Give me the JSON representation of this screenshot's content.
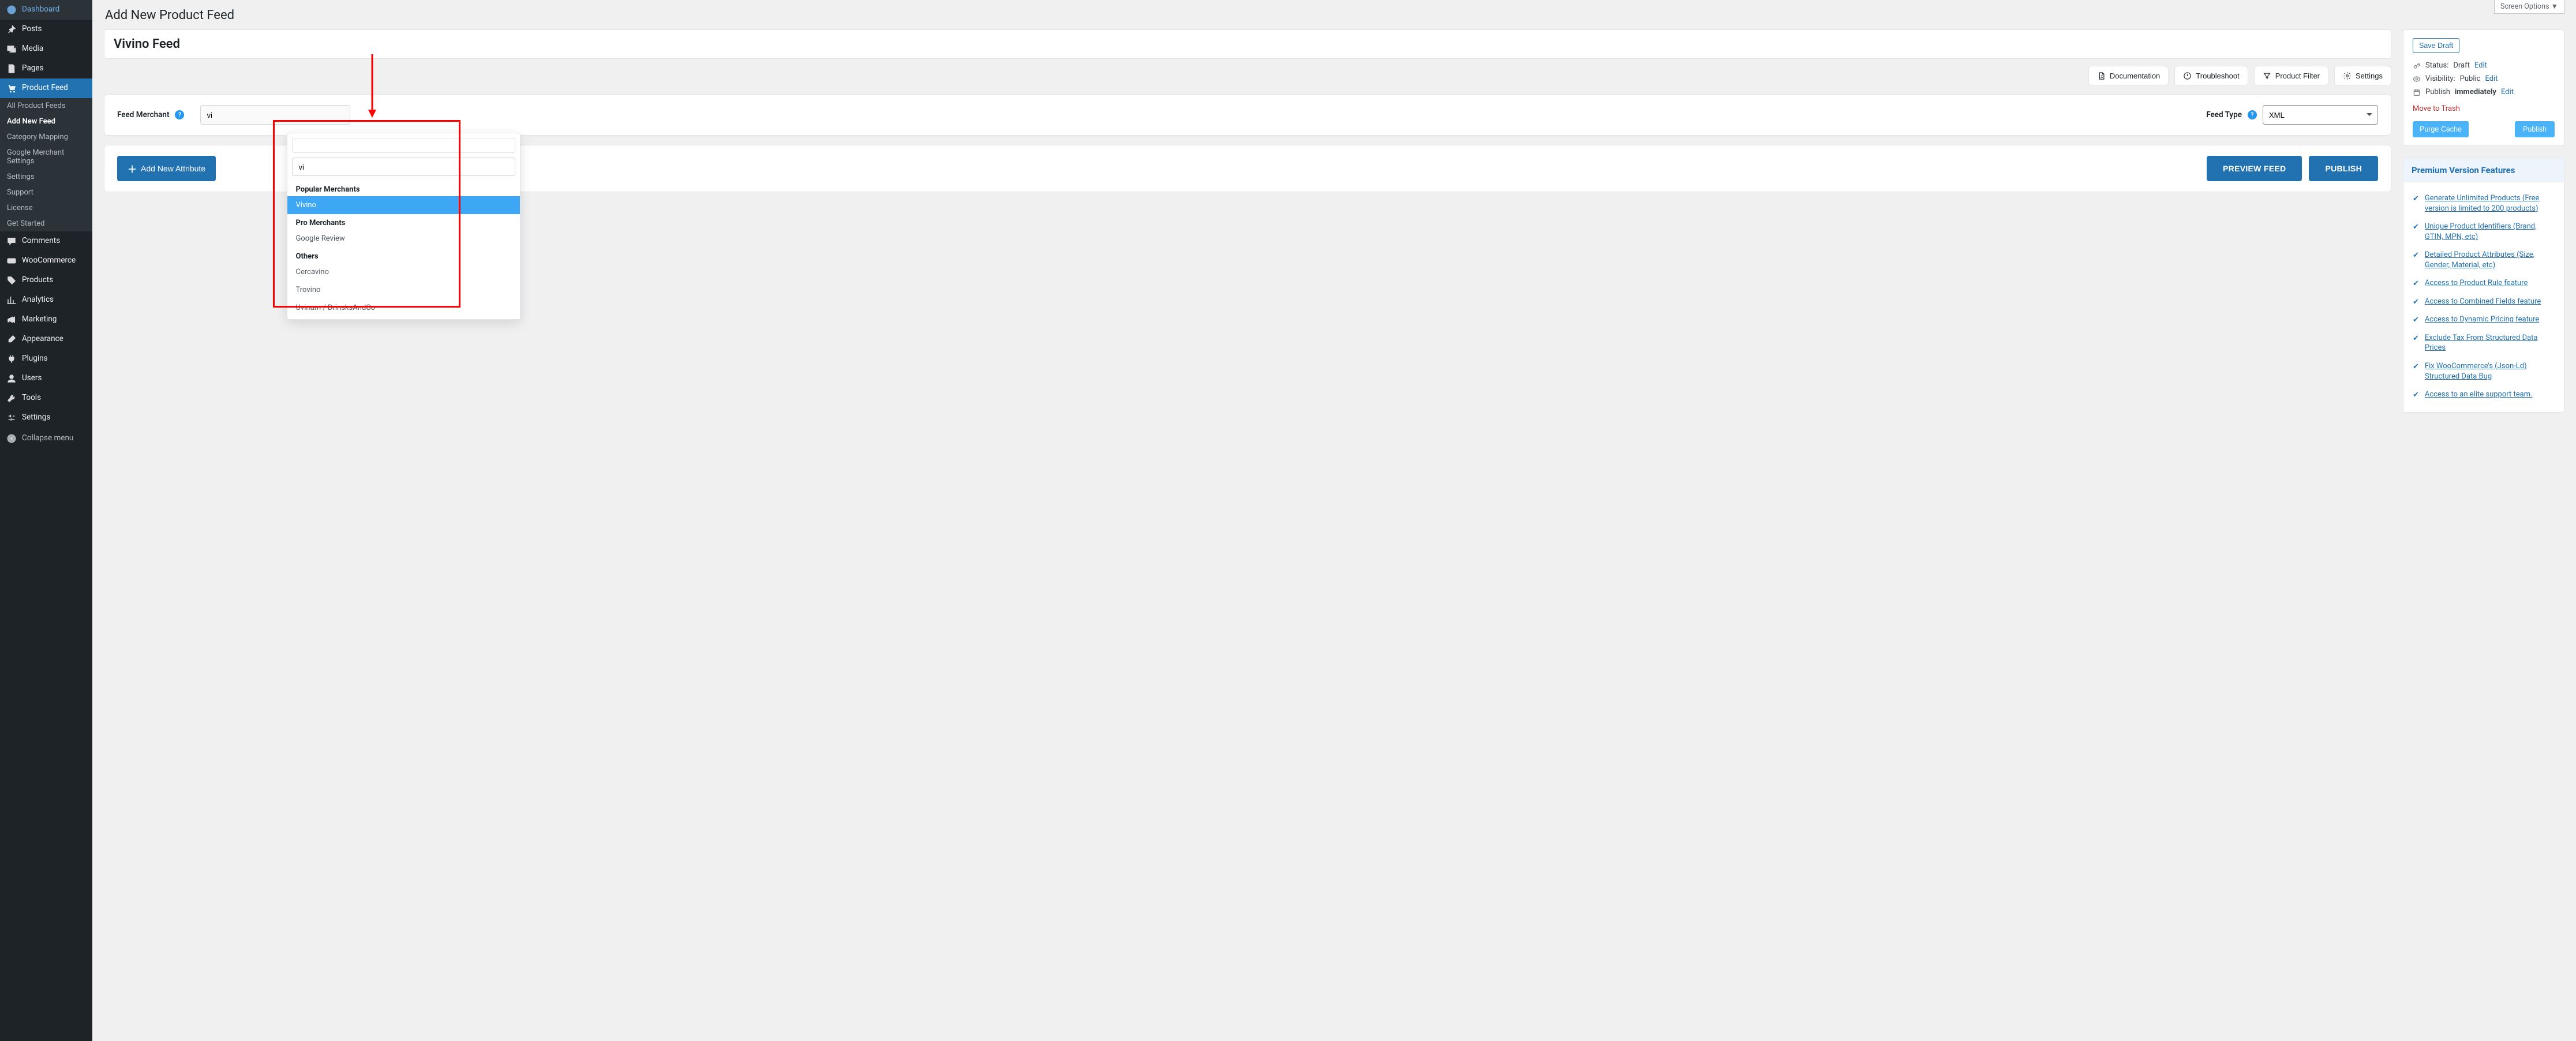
{
  "page": {
    "heading": "Add New Product Feed",
    "title": "Vivino Feed"
  },
  "screen_options": "Screen Options ▼",
  "sidebar": [
    {
      "label": "Dashboard",
      "icon": "gauge"
    },
    {
      "label": "Posts",
      "icon": "pin"
    },
    {
      "label": "Media",
      "icon": "media"
    },
    {
      "label": "Pages",
      "icon": "pages"
    },
    {
      "label": "Product Feed",
      "icon": "cart",
      "current": true,
      "sub": [
        {
          "label": "All Product Feeds"
        },
        {
          "label": "Add New Feed",
          "current": true
        },
        {
          "label": "Category Mapping"
        },
        {
          "label": "Google Merchant Settings"
        },
        {
          "label": "Settings"
        },
        {
          "label": "Support"
        },
        {
          "label": "License"
        },
        {
          "label": "Get Started"
        }
      ]
    },
    {
      "label": "Comments",
      "icon": "comment"
    },
    {
      "label": "WooCommerce",
      "icon": "woo"
    },
    {
      "label": "Products",
      "icon": "tag"
    },
    {
      "label": "Analytics",
      "icon": "chart"
    },
    {
      "label": "Marketing",
      "icon": "megaphone"
    },
    {
      "label": "Appearance",
      "icon": "brush"
    },
    {
      "label": "Plugins",
      "icon": "plug"
    },
    {
      "label": "Users",
      "icon": "user"
    },
    {
      "label": "Tools",
      "icon": "wrench"
    },
    {
      "label": "Settings",
      "icon": "sliders"
    }
  ],
  "collapse_label": "Collapse menu",
  "action_bar": {
    "documentation": "Documentation",
    "troubleshoot": "Troubleshoot",
    "filter": "Product Filter",
    "settings": "Settings"
  },
  "merchant_panel": {
    "merchant_label": "Feed Merchant",
    "search_value": "vi",
    "feed_type_label": "Feed Type",
    "feed_type_value": "XML"
  },
  "dropdown": {
    "sections": [
      {
        "title": "Popular Merchants",
        "items": [
          {
            "label": "Vivino",
            "selected": true
          }
        ]
      },
      {
        "title": "Pro Merchants",
        "items": [
          {
            "label": "Google Review"
          }
        ]
      },
      {
        "title": "Others",
        "items": [
          {
            "label": "Cercavino"
          },
          {
            "label": "Trovino"
          },
          {
            "label": "Uvinum / DrinsksAndCo"
          }
        ]
      }
    ]
  },
  "buttons": {
    "add_attr": "Add New Attribute",
    "preview": "PREVIEW FEED",
    "publish": "PUBLISH"
  },
  "publish_box": {
    "save_draft": "Save Draft",
    "status_label": "Status:",
    "status_value": "Draft",
    "visibility_label": "Visibility:",
    "visibility_value": "Public",
    "publish_label": "Publish",
    "publish_value": "immediately",
    "edit": "Edit",
    "trash": "Move to Trash",
    "purge": "Purge Cache",
    "publish_btn": "Publish"
  },
  "premium": {
    "heading": "Premium Version Features",
    "items": [
      "Generate Unlimited Products (Free version is limited to 200 products)",
      "Unique Product Identifiers (Brand, GTIN, MPN, etc)",
      "Detailed Product Attributes (Size, Gender, Material, etc)",
      "Access to Product Rule feature",
      "Access to Combined Fields feature",
      "Access to Dynamic Pricing feature",
      "Exclude Tax From Structured Data Prices",
      "Fix WooCommerce's (Json-Ld) Structured Data Bug",
      "Access to an elite support team."
    ]
  }
}
